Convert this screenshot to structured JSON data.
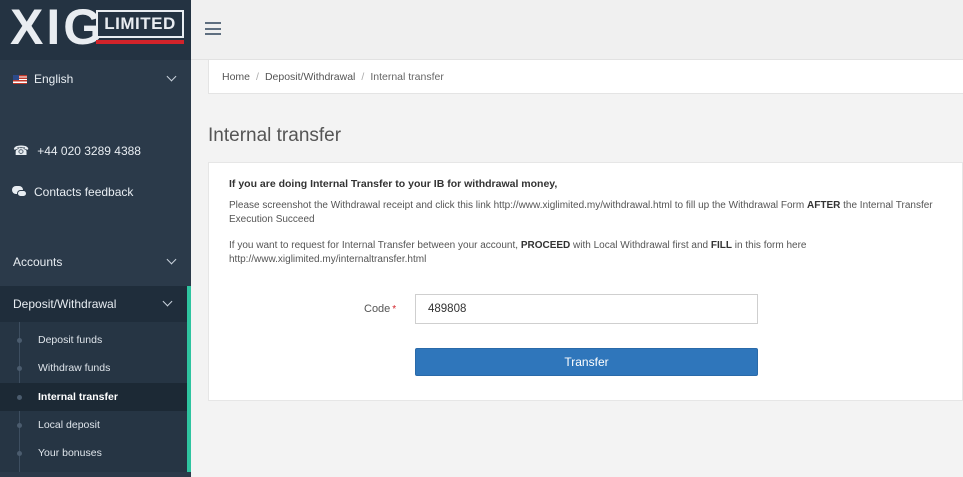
{
  "logo": {
    "mark": "XIG",
    "suffix": "LIMITED"
  },
  "sidebar": {
    "language": "English",
    "phone": "+44 020 3289 4388",
    "contacts": "Contacts feedback",
    "accounts": "Accounts",
    "deposit_withdrawal": "Deposit/Withdrawal",
    "submenu": [
      {
        "label": "Deposit funds",
        "active": false
      },
      {
        "label": "Withdraw funds",
        "active": false
      },
      {
        "label": "Internal transfer",
        "active": true
      },
      {
        "label": "Local deposit",
        "active": false
      },
      {
        "label": "Your bonuses",
        "active": false
      }
    ]
  },
  "breadcrumb": {
    "home": "Home",
    "section": "Deposit/Withdrawal",
    "current": "Internal transfer"
  },
  "page": {
    "title": "Internal transfer"
  },
  "info": {
    "heading": "If you are doing Internal Transfer to your IB for withdrawal money,",
    "line1_a": "Please screenshot the Withdrawal receipt and click this link http://www.xiglimited.my/withdrawal.html to fill up the Withdrawal Form ",
    "line1_b": "AFTER",
    "line1_c": " the Internal Transfer Execution Succeed",
    "line2_a": "If you want to request for Internal Transfer between your account, ",
    "line2_b": "PROCEED",
    "line2_c": " with Local Withdrawal first and ",
    "line2_d": "FILL",
    "line2_e": " in this form here http://www.xiglimited.my/internaltransfer.html"
  },
  "form": {
    "code_label": "Code",
    "required_mark": "*",
    "code_value": "489808",
    "submit_label": "Transfer"
  },
  "colors": {
    "sidebar": "#2b3a4a",
    "accent": "#2ec4a0",
    "primary_button": "#2f76bb",
    "logo_red": "#d2232a"
  }
}
